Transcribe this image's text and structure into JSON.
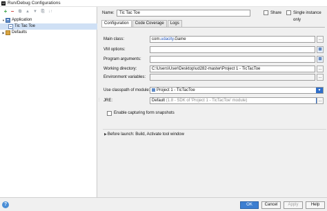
{
  "window": {
    "title": "Run/Debug Configurations",
    "app_icon_letter": "IJ"
  },
  "toolbar": {
    "add_glyph": "+",
    "remove_glyph": "−",
    "more_glyphs": [
      "⧉",
      "▲",
      "▼",
      "⎘",
      "↓↑"
    ]
  },
  "tree": {
    "items": [
      {
        "label": "Application",
        "arrow": "▼"
      },
      {
        "label": "Tic Tac Toe",
        "arrow": ""
      },
      {
        "label": "Defaults",
        "arrow": "▶"
      }
    ]
  },
  "splitter_glyph": "⋮",
  "config": {
    "name_label": "Name:",
    "name_value": "Tic Tac Toe",
    "share_label": "Share",
    "single_instance_label": "Single instance only",
    "tabs": [
      "Configuration",
      "Code Coverage",
      "Logs"
    ],
    "main_class_label": "Main class:",
    "main_class_value": {
      "prefix": "com.",
      "highlight": "udacity",
      "suffix": ".Game"
    },
    "vm_options_label": "VM options:",
    "program_args_label": "Program arguments:",
    "working_dir_label": "Working directory:",
    "working_dir_value": "C:\\Users\\User\\Desktop\\ud282-master\\Project 1 - TicTacToe",
    "env_vars_label": "Environment variables:",
    "classpath_label": "Use classpath of module:",
    "classpath_value": "Project 1 - TicTacToe",
    "jre_label": "JRE:",
    "jre_value": "Default",
    "jre_detail": "(1.8 - SDK of 'Project 1 - TicTacToe' module)",
    "form_snapshots_label": "Enable capturing form snapshots",
    "ellipsis_glyph": "...",
    "expand_glyph": "⊞",
    "dropdown_glyph": "▼",
    "before_launch_arrow": "▶",
    "before_launch_label": "Before launch: Build, Activate tool window"
  },
  "buttons": {
    "help_glyph": "?",
    "ok": "OK",
    "cancel": "Cancel",
    "apply": "Apply",
    "help": "Help"
  }
}
